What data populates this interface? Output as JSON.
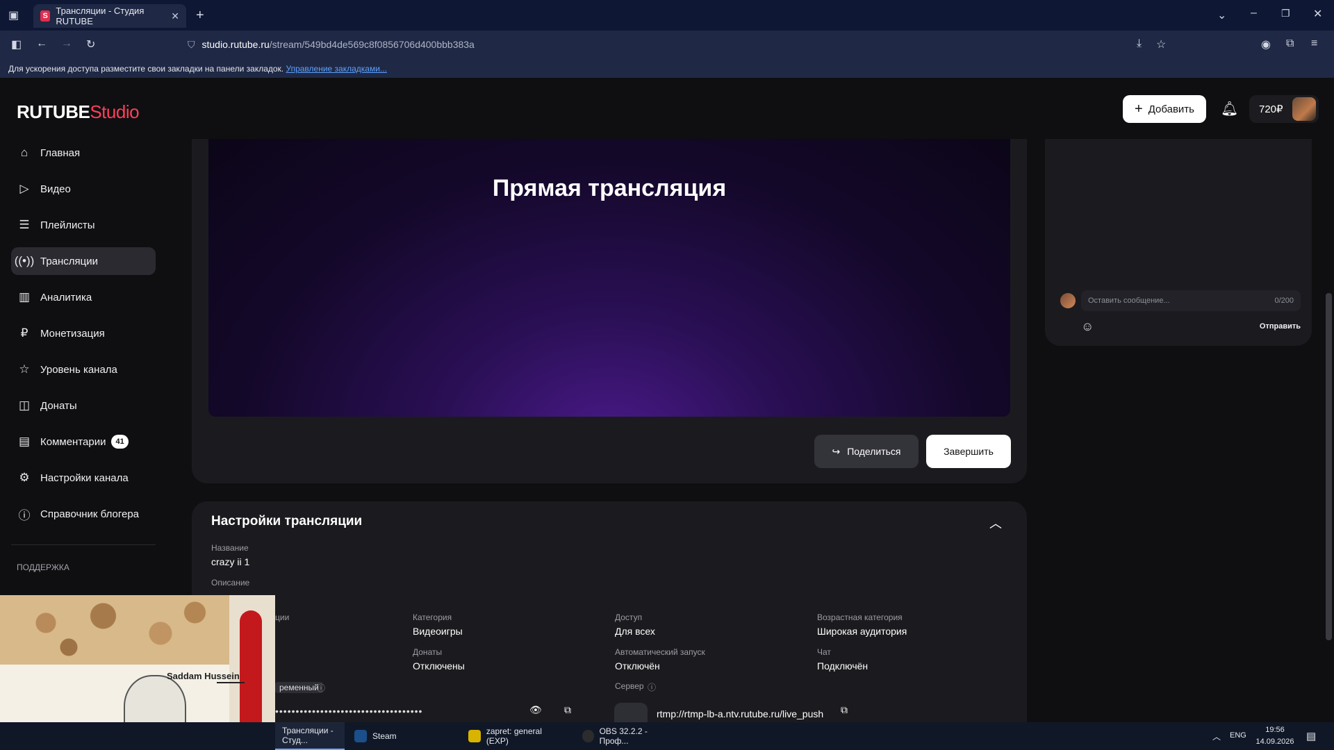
{
  "browser": {
    "tab_title": "Трансляции - Студия RUTUBE",
    "tab_favicon": "S",
    "url_host": "studio.rutube.ru",
    "url_path": "/stream/549bd4de569c8f0856706d400bbb383a",
    "bookmarks_hint": "Для ускорения доступа разместите свои закладки на панели закладок.",
    "bookmarks_link": "Управление закладками..."
  },
  "header": {
    "logo_main": "RUTUBE",
    "logo_suffix": "Studio",
    "add_button": "Добавить",
    "wallet": "720₽"
  },
  "sidebar": {
    "items": [
      {
        "label": "Главная",
        "icon": "home-icon"
      },
      {
        "label": "Видео",
        "icon": "video-icon"
      },
      {
        "label": "Плейлисты",
        "icon": "playlist-icon"
      },
      {
        "label": "Трансляции",
        "icon": "broadcast-icon"
      },
      {
        "label": "Аналитика",
        "icon": "analytics-icon"
      },
      {
        "label": "Монетизация",
        "icon": "ruble-icon"
      },
      {
        "label": "Уровень канала",
        "icon": "star-icon"
      },
      {
        "label": "Донаты",
        "icon": "donate-icon"
      },
      {
        "label": "Комментарии",
        "icon": "comment-icon",
        "badge": "41"
      },
      {
        "label": "Настройки канала",
        "icon": "gear-icon"
      },
      {
        "label": "Справочник блогера",
        "icon": "info-icon"
      }
    ],
    "support_label": "ПОДДЕРЖКА"
  },
  "player": {
    "title": "Прямая трансляция",
    "share_button": "Поделиться",
    "end_button": "Завершить"
  },
  "settings": {
    "title": "Настройки трансляции",
    "name_label": "Название",
    "name_value": "crazy ii 1",
    "description_label": "Описание",
    "category_label": "Категория",
    "category_value": "Видеоигры",
    "donations_label": "Донаты",
    "donations_value": "Отключены",
    "access_label": "Доступ",
    "access_value": "Для всех",
    "autostart_label": "Автоматический запуск",
    "autostart_value": "Отключён",
    "age_label": "Возрастная категория",
    "age_value": "Широкая аудитория",
    "chat_label": "Чат",
    "chat_value": "Подключён",
    "server_label": "Сервер",
    "server_value": "rtmp://rtmp-lb-a.ntv.rutube.ru/live_push",
    "stream_type_tag": "ременный",
    "partial_label": "ции"
  },
  "chat": {
    "placeholder": "Оставить сообщение...",
    "counter": "0/200",
    "send_button": "Отправить"
  },
  "taskbar": {
    "items": [
      "Трансляции - Студ...",
      "Steam",
      "zapret: general (EXP)",
      "OBS 32.2.2 - Проф..."
    ],
    "lang": "ENG",
    "time": "19:56",
    "date": "14.09.2026"
  },
  "overlay": {
    "caption": "Saddam Hussein"
  },
  "colors": {
    "accent": "#ff3e5a",
    "panel": "#1b1b1f",
    "background": "#0f0f11"
  }
}
